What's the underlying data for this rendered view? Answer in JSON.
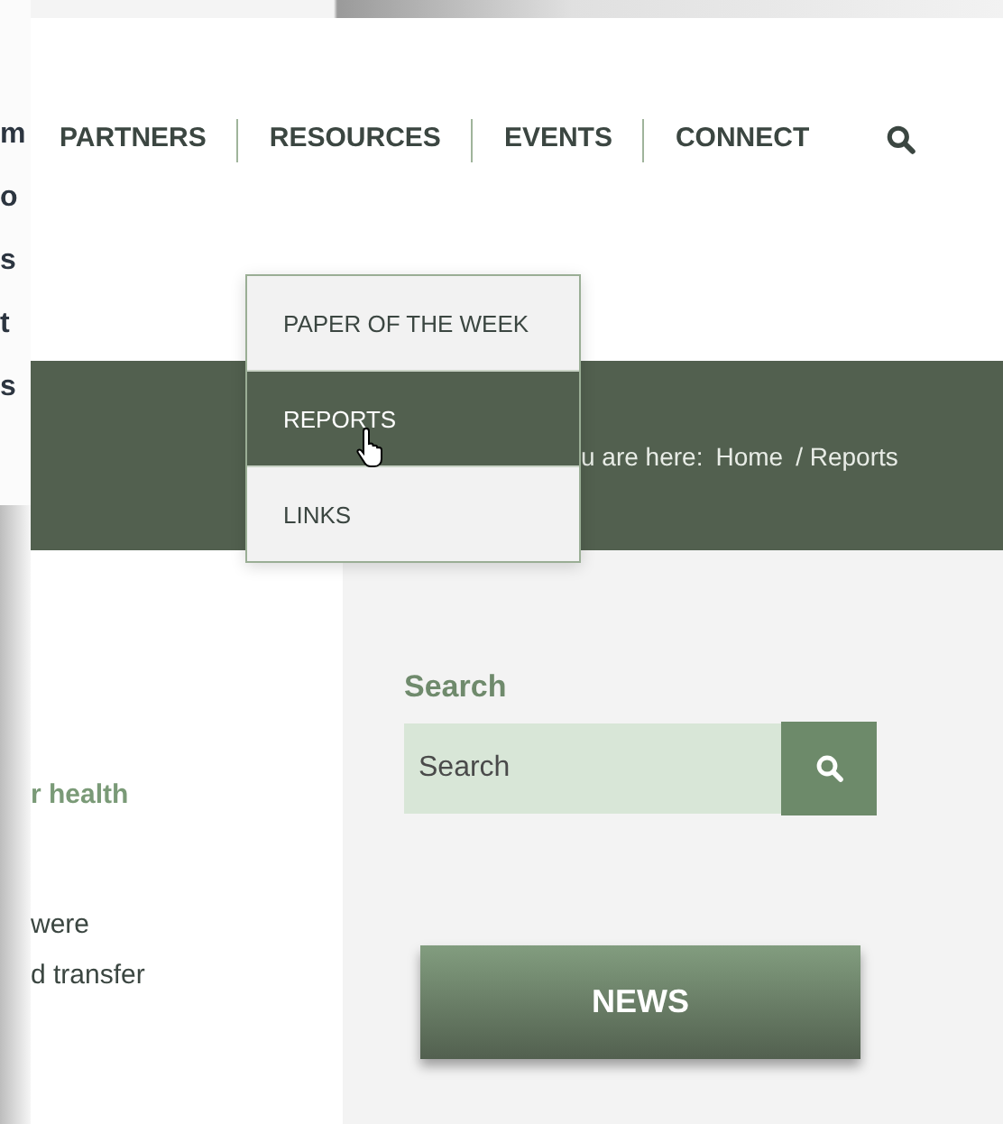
{
  "back_window": {
    "fragments": [
      "m",
      "o",
      "s",
      "t",
      "s"
    ]
  },
  "nav": {
    "items": [
      {
        "label": "PARTNERS"
      },
      {
        "label": "RESOURCES"
      },
      {
        "label": "EVENTS"
      },
      {
        "label": "CONNECT"
      }
    ]
  },
  "dropdown": {
    "items": [
      {
        "label": "PAPER OF THE WEEK",
        "selected": false
      },
      {
        "label": "REPORTS",
        "selected": true
      },
      {
        "label": "LINKS",
        "selected": false
      }
    ]
  },
  "breadcrumb": [
    "u are here:",
    "Home",
    "/ Reports"
  ],
  "article": {
    "lines": [
      {
        "text": "r health",
        "kind": "heading"
      },
      {
        "text": "were",
        "kind": "body"
      },
      {
        "text": "d transfer",
        "kind": "body"
      }
    ]
  },
  "sidebar": {
    "search_title": "Search",
    "search": {
      "placeholder": "Search"
    },
    "news_button": "NEWS"
  }
}
